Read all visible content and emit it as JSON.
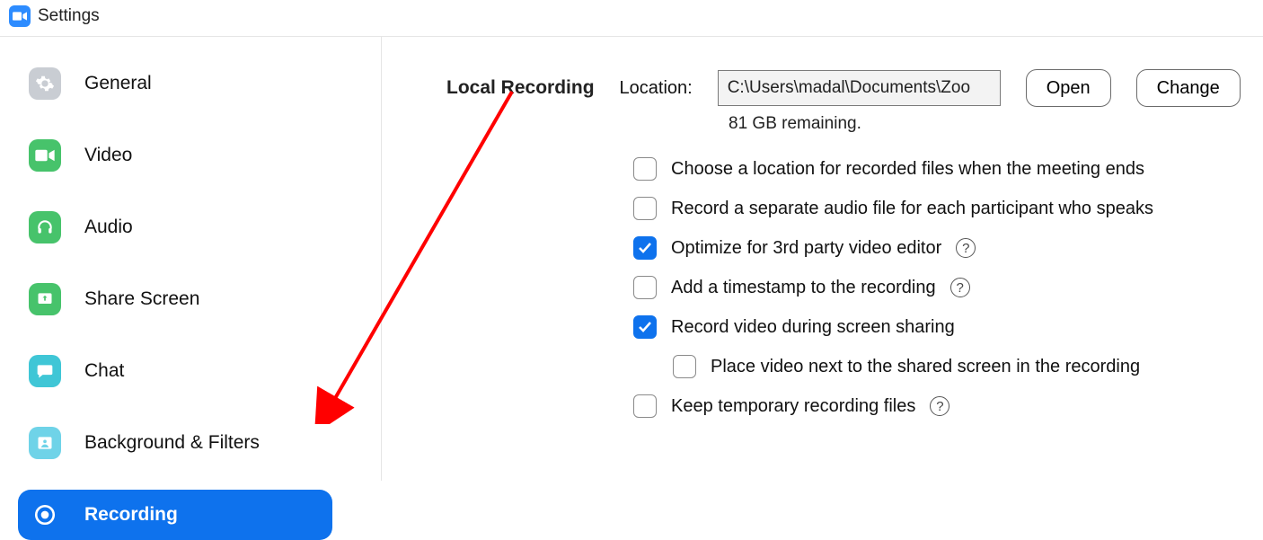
{
  "window": {
    "title": "Settings"
  },
  "sidebar": {
    "items": [
      {
        "label": "General"
      },
      {
        "label": "Video"
      },
      {
        "label": "Audio"
      },
      {
        "label": "Share Screen"
      },
      {
        "label": "Chat"
      },
      {
        "label": "Background & Filters"
      },
      {
        "label": "Recording"
      }
    ],
    "active_index": 6
  },
  "main": {
    "section_title": "Local Recording",
    "location_label": "Location:",
    "location_value": "C:\\Users\\madal\\Documents\\Zoo",
    "open_label": "Open",
    "change_label": "Change",
    "remaining": "81 GB remaining.",
    "options": [
      {
        "label": "Choose a location for recorded files when the meeting ends",
        "checked": false,
        "help": false,
        "indent": false
      },
      {
        "label": "Record a separate audio file for each participant who speaks",
        "checked": false,
        "help": false,
        "indent": false
      },
      {
        "label": "Optimize for 3rd party video editor",
        "checked": true,
        "help": true,
        "indent": false
      },
      {
        "label": "Add a timestamp to the recording",
        "checked": false,
        "help": true,
        "indent": false
      },
      {
        "label": "Record video during screen sharing",
        "checked": true,
        "help": false,
        "indent": false
      },
      {
        "label": "Place video next to the shared screen in the recording",
        "checked": false,
        "help": false,
        "indent": true
      },
      {
        "label": "Keep temporary recording files",
        "checked": false,
        "help": true,
        "indent": false
      }
    ]
  },
  "colors": {
    "accent": "#0e72ed",
    "icon_gray": "#c9cdd3",
    "icon_green": "#47c36b",
    "icon_teal": "#3fc6d6",
    "icon_lightblue": "#6fd3e8",
    "arrow": "#ff0000"
  }
}
